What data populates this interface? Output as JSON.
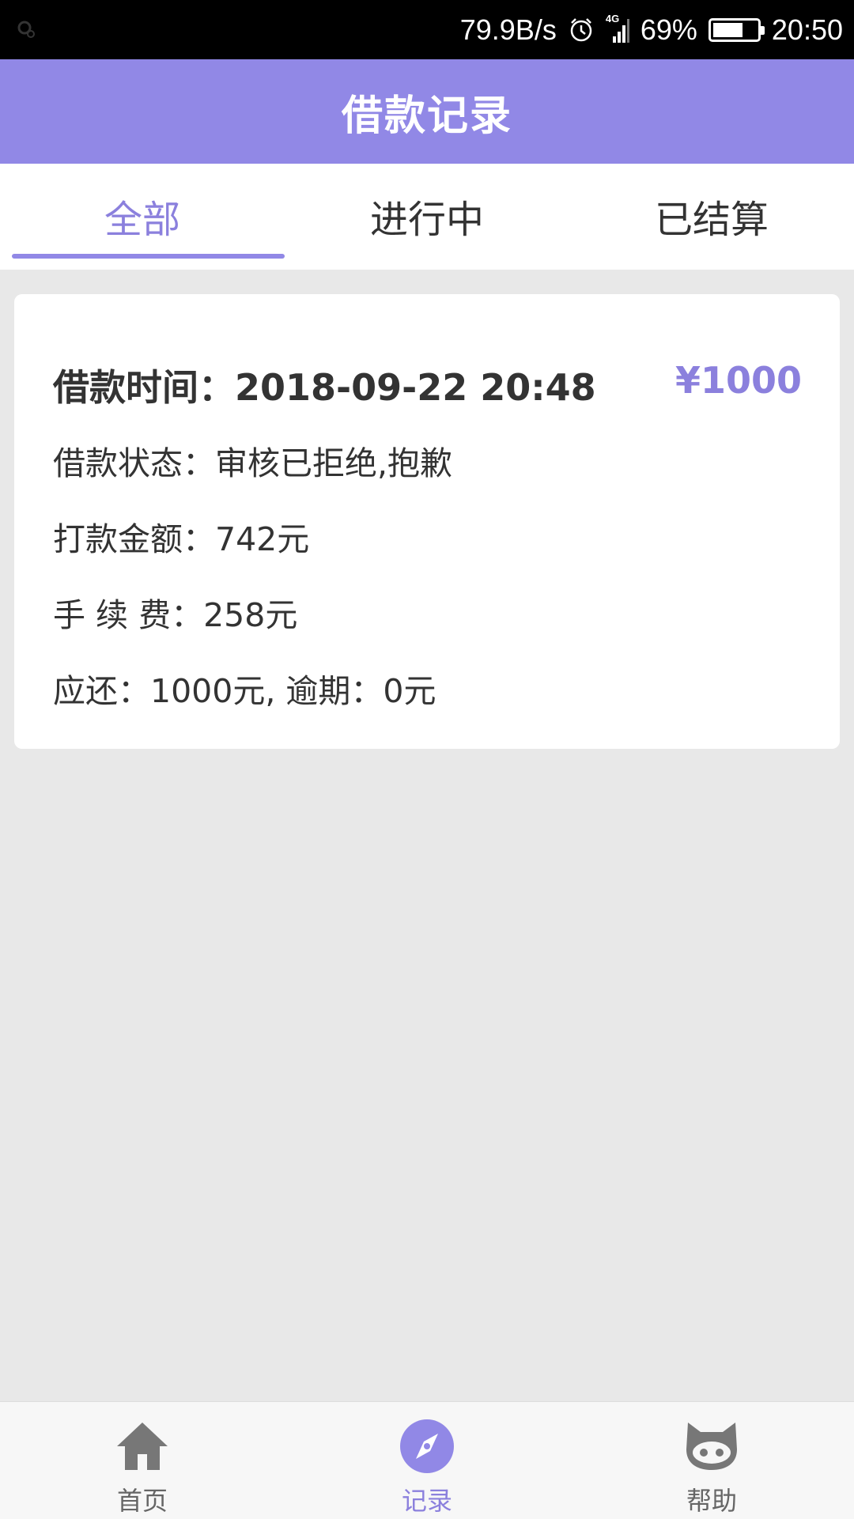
{
  "status_bar": {
    "speed": "79.9B/s",
    "network": "4G",
    "battery_percent": "69%",
    "battery_level": 0.69,
    "time": "20:50"
  },
  "header": {
    "title": "借款记录"
  },
  "tabs": [
    {
      "label": "全部",
      "active": true
    },
    {
      "label": "进行中",
      "active": false
    },
    {
      "label": "已结算",
      "active": false
    }
  ],
  "record": {
    "time_label": "借款时间：2018-09-22 20:48",
    "amount": "¥1000",
    "status": "借款状态：审核已拒绝,抱歉",
    "paid_amount": "打款金额：742元",
    "fee": "手 续 费：258元",
    "due": "应还：1000元, 逾期：0元"
  },
  "bottom_nav": [
    {
      "label": "首页",
      "icon": "home-icon",
      "active": false
    },
    {
      "label": "记录",
      "icon": "compass-icon",
      "active": true
    },
    {
      "label": "帮助",
      "icon": "cat-face-icon",
      "active": false
    }
  ],
  "colors": {
    "accent": "#9188e6",
    "accent_text": "#8b80dd",
    "background": "#e8e8e8",
    "text": "#333333"
  }
}
